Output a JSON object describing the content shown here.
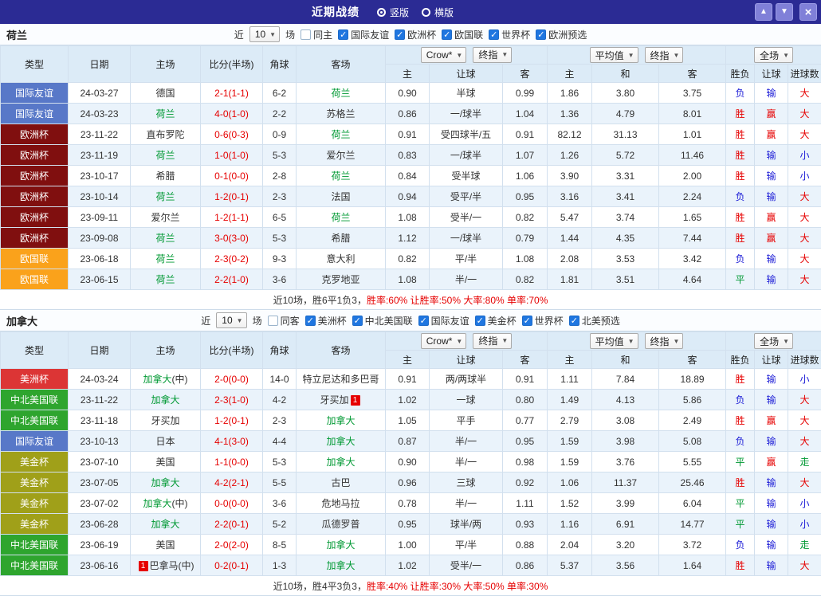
{
  "titlebar": {
    "title": "近期战绩",
    "radios": [
      {
        "label": "竖版",
        "selected": true
      },
      {
        "label": "横版",
        "selected": false
      }
    ],
    "buttons": {
      "up": "▲",
      "down": "▼",
      "close": "×"
    }
  },
  "colors": {
    "league": {
      "国际友谊": "#5878c8",
      "欧洲杯": "#800f0f",
      "欧国联": "#faa21b",
      "美洲杯": "#dc3535",
      "中北美国联": "#2ea52e",
      "美金杯": "#a0a019"
    },
    "result": {
      "胜": "#e60000",
      "负": "#1a1ad6",
      "平": "#009933",
      "赢": "#e60000",
      "输": "#1a1ad6",
      "大": "#e60000",
      "小": "#1a1ad6",
      "走": "#009933"
    }
  },
  "table_header": {
    "cols": [
      "类型",
      "日期",
      "主场",
      "比分(半场)",
      "角球",
      "客场"
    ],
    "sub": [
      "主",
      "让球",
      "客",
      "主",
      "和",
      "客",
      "胜负",
      "让球",
      "进球数"
    ],
    "selects": {
      "odds1": "Crow*",
      "odds2": "终指",
      "avg1": "平均值",
      "avg2": "终指",
      "scope": "全场"
    }
  },
  "sections": [
    {
      "team": "荷兰",
      "filter": {
        "near_label": "近",
        "count": "10",
        "games_label": "场",
        "same_label": "同主",
        "same_checked": false,
        "leagues": [
          {
            "label": "国际友谊",
            "checked": true
          },
          {
            "label": "欧洲杯",
            "checked": true
          },
          {
            "label": "欧国联",
            "checked": true
          },
          {
            "label": "世界杯",
            "checked": true
          },
          {
            "label": "欧洲预选",
            "checked": true
          }
        ]
      },
      "rows": [
        {
          "league": "国际友谊",
          "date": "24-03-27",
          "home": [
            {
              "text": "德国"
            }
          ],
          "score": "2-1(1-1)",
          "corner": "6-2",
          "away": [
            {
              "text": "荷兰",
              "focus": true
            }
          ],
          "odds": [
            "0.90",
            "半球",
            "0.99"
          ],
          "avg": [
            "1.86",
            "3.80",
            "3.75"
          ],
          "res": [
            "负",
            "输",
            "大"
          ]
        },
        {
          "league": "国际友谊",
          "date": "24-03-23",
          "home": [
            {
              "text": "荷兰",
              "focus": true
            }
          ],
          "score": "4-0(1-0)",
          "corner": "2-2",
          "away": [
            {
              "text": "苏格兰"
            }
          ],
          "odds": [
            "0.86",
            "一/球半",
            "1.04"
          ],
          "avg": [
            "1.36",
            "4.79",
            "8.01"
          ],
          "res": [
            "胜",
            "赢",
            "大"
          ]
        },
        {
          "league": "欧洲杯",
          "date": "23-11-22",
          "home": [
            {
              "text": "直布罗陀"
            }
          ],
          "score": "0-6(0-3)",
          "corner": "0-9",
          "away": [
            {
              "text": "荷兰",
              "focus": true
            }
          ],
          "odds": [
            "0.91",
            "受四球半/五",
            "0.91"
          ],
          "avg": [
            "82.12",
            "31.13",
            "1.01"
          ],
          "res": [
            "胜",
            "赢",
            "大"
          ]
        },
        {
          "league": "欧洲杯",
          "date": "23-11-19",
          "home": [
            {
              "text": "荷兰",
              "focus": true
            }
          ],
          "score": "1-0(1-0)",
          "corner": "5-3",
          "away": [
            {
              "text": "爱尔兰"
            }
          ],
          "odds": [
            "0.83",
            "一/球半",
            "1.07"
          ],
          "avg": [
            "1.26",
            "5.72",
            "11.46"
          ],
          "res": [
            "胜",
            "输",
            "小"
          ]
        },
        {
          "league": "欧洲杯",
          "date": "23-10-17",
          "home": [
            {
              "text": "希腊"
            }
          ],
          "score": "0-1(0-0)",
          "corner": "2-8",
          "away": [
            {
              "text": "荷兰",
              "focus": true
            }
          ],
          "odds": [
            "0.84",
            "受半球",
            "1.06"
          ],
          "avg": [
            "3.90",
            "3.31",
            "2.00"
          ],
          "res": [
            "胜",
            "输",
            "小"
          ]
        },
        {
          "league": "欧洲杯",
          "date": "23-10-14",
          "home": [
            {
              "text": "荷兰",
              "focus": true
            }
          ],
          "score": "1-2(0-1)",
          "corner": "2-3",
          "away": [
            {
              "text": "法国"
            }
          ],
          "odds": [
            "0.94",
            "受平/半",
            "0.95"
          ],
          "avg": [
            "3.16",
            "3.41",
            "2.24"
          ],
          "res": [
            "负",
            "输",
            "大"
          ]
        },
        {
          "league": "欧洲杯",
          "date": "23-09-11",
          "home": [
            {
              "text": "爱尔兰"
            }
          ],
          "score": "1-2(1-1)",
          "corner": "6-5",
          "away": [
            {
              "text": "荷兰",
              "focus": true
            }
          ],
          "odds": [
            "1.08",
            "受半/一",
            "0.82"
          ],
          "avg": [
            "5.47",
            "3.74",
            "1.65"
          ],
          "res": [
            "胜",
            "赢",
            "大"
          ]
        },
        {
          "league": "欧洲杯",
          "date": "23-09-08",
          "home": [
            {
              "text": "荷兰",
              "focus": true
            }
          ],
          "score": "3-0(3-0)",
          "corner": "5-3",
          "away": [
            {
              "text": "希腊"
            }
          ],
          "odds": [
            "1.12",
            "一/球半",
            "0.79"
          ],
          "avg": [
            "1.44",
            "4.35",
            "7.44"
          ],
          "res": [
            "胜",
            "赢",
            "大"
          ]
        },
        {
          "league": "欧国联",
          "date": "23-06-18",
          "home": [
            {
              "text": "荷兰",
              "focus": true
            }
          ],
          "score": "2-3(0-2)",
          "corner": "9-3",
          "away": [
            {
              "text": "意大利"
            }
          ],
          "odds": [
            "0.82",
            "平/半",
            "1.08"
          ],
          "avg": [
            "2.08",
            "3.53",
            "3.42"
          ],
          "res": [
            "负",
            "输",
            "大"
          ]
        },
        {
          "league": "欧国联",
          "date": "23-06-15",
          "home": [
            {
              "text": "荷兰",
              "focus": true
            }
          ],
          "score": "2-2(1-0)",
          "corner": "3-6",
          "away": [
            {
              "text": "克罗地亚"
            }
          ],
          "odds": [
            "1.08",
            "半/一",
            "0.82"
          ],
          "avg": [
            "1.81",
            "3.51",
            "4.64"
          ],
          "res": [
            "平",
            "输",
            "大"
          ]
        }
      ],
      "summary": [
        {
          "text": "近10场，胜6平1负3，",
          "color": "#333333"
        },
        {
          "text": "胜率:60%",
          "color": "#e60000"
        },
        {
          "text": " 让胜率:50%",
          "color": "#e60000"
        },
        {
          "text": " 大率:80%",
          "color": "#e60000"
        },
        {
          "text": " 单率:70%",
          "color": "#e60000"
        }
      ]
    },
    {
      "team": "加拿大",
      "filter": {
        "near_label": "近",
        "count": "10",
        "games_label": "场",
        "same_label": "同客",
        "same_checked": false,
        "leagues": [
          {
            "label": "美洲杯",
            "checked": true
          },
          {
            "label": "中北美国联",
            "checked": true
          },
          {
            "label": "国际友谊",
            "checked": true
          },
          {
            "label": "美金杯",
            "checked": true
          },
          {
            "label": "世界杯",
            "checked": true
          },
          {
            "label": "北美预选",
            "checked": true
          }
        ]
      },
      "rows": [
        {
          "league": "美洲杯",
          "date": "24-03-24",
          "home": [
            {
              "text": "加拿大",
              "focus": true
            },
            {
              "text": "(中)"
            }
          ],
          "score": "2-0(0-0)",
          "corner": "14-0",
          "away": [
            {
              "text": "特立尼达和多巴哥"
            }
          ],
          "odds": [
            "0.91",
            "两/两球半",
            "0.91"
          ],
          "avg": [
            "1.11",
            "7.84",
            "18.89"
          ],
          "res": [
            "胜",
            "输",
            "小"
          ]
        },
        {
          "league": "中北美国联",
          "date": "23-11-22",
          "home": [
            {
              "text": "加拿大",
              "focus": true
            }
          ],
          "score": "2-3(1-0)",
          "corner": "4-2",
          "away": [
            {
              "text": "牙买加"
            },
            {
              "card": "1"
            }
          ],
          "odds": [
            "1.02",
            "一球",
            "0.80"
          ],
          "avg": [
            "1.49",
            "4.13",
            "5.86"
          ],
          "res": [
            "负",
            "输",
            "大"
          ]
        },
        {
          "league": "中北美国联",
          "date": "23-11-18",
          "home": [
            {
              "text": "牙买加"
            }
          ],
          "score": "1-2(0-1)",
          "corner": "2-3",
          "away": [
            {
              "text": "加拿大",
              "focus": true
            }
          ],
          "odds": [
            "1.05",
            "平手",
            "0.77"
          ],
          "avg": [
            "2.79",
            "3.08",
            "2.49"
          ],
          "res": [
            "胜",
            "赢",
            "大"
          ]
        },
        {
          "league": "国际友谊",
          "date": "23-10-13",
          "home": [
            {
              "text": "日本"
            }
          ],
          "score": "4-1(3-0)",
          "corner": "4-4",
          "away": [
            {
              "text": "加拿大",
              "focus": true
            }
          ],
          "odds": [
            "0.87",
            "半/一",
            "0.95"
          ],
          "avg": [
            "1.59",
            "3.98",
            "5.08"
          ],
          "res": [
            "负",
            "输",
            "大"
          ]
        },
        {
          "league": "美金杯",
          "date": "23-07-10",
          "home": [
            {
              "text": "美国"
            }
          ],
          "score": "1-1(0-0)",
          "corner": "5-3",
          "away": [
            {
              "text": "加拿大",
              "focus": true
            }
          ],
          "odds": [
            "0.90",
            "半/一",
            "0.98"
          ],
          "avg": [
            "1.59",
            "3.76",
            "5.55"
          ],
          "res": [
            "平",
            "赢",
            "走"
          ]
        },
        {
          "league": "美金杯",
          "date": "23-07-05",
          "home": [
            {
              "text": "加拿大",
              "focus": true
            }
          ],
          "score": "4-2(2-1)",
          "corner": "5-5",
          "away": [
            {
              "text": "古巴"
            }
          ],
          "odds": [
            "0.96",
            "三球",
            "0.92"
          ],
          "avg": [
            "1.06",
            "11.37",
            "25.46"
          ],
          "res": [
            "胜",
            "输",
            "大"
          ]
        },
        {
          "league": "美金杯",
          "date": "23-07-02",
          "home": [
            {
              "text": "加拿大",
              "focus": true
            },
            {
              "text": "(中)"
            }
          ],
          "score": "0-0(0-0)",
          "corner": "3-6",
          "away": [
            {
              "text": "危地马拉"
            }
          ],
          "odds": [
            "0.78",
            "半/一",
            "1.11"
          ],
          "avg": [
            "1.52",
            "3.99",
            "6.04"
          ],
          "res": [
            "平",
            "输",
            "小"
          ]
        },
        {
          "league": "美金杯",
          "date": "23-06-28",
          "home": [
            {
              "text": "加拿大",
              "focus": true
            }
          ],
          "score": "2-2(0-1)",
          "corner": "5-2",
          "away": [
            {
              "text": "瓜德罗普"
            }
          ],
          "odds": [
            "0.95",
            "球半/两",
            "0.93"
          ],
          "avg": [
            "1.16",
            "6.91",
            "14.77"
          ],
          "res": [
            "平",
            "输",
            "小"
          ]
        },
        {
          "league": "中北美国联",
          "date": "23-06-19",
          "home": [
            {
              "text": "美国"
            }
          ],
          "score": "2-0(2-0)",
          "corner": "8-5",
          "away": [
            {
              "text": "加拿大",
              "focus": true
            }
          ],
          "odds": [
            "1.00",
            "平/半",
            "0.88"
          ],
          "avg": [
            "2.04",
            "3.20",
            "3.72"
          ],
          "res": [
            "负",
            "输",
            "走"
          ]
        },
        {
          "league": "中北美国联",
          "date": "23-06-16",
          "home": [
            {
              "card": "1"
            },
            {
              "text": "巴拿马(中)"
            }
          ],
          "score": "0-2(0-1)",
          "corner": "1-3",
          "away": [
            {
              "text": "加拿大",
              "focus": true
            }
          ],
          "odds": [
            "1.02",
            "受半/一",
            "0.86"
          ],
          "avg": [
            "5.37",
            "3.56",
            "1.64"
          ],
          "res": [
            "胜",
            "输",
            "大"
          ]
        }
      ],
      "summary": [
        {
          "text": "近10场，胜4平3负3，",
          "color": "#333333"
        },
        {
          "text": "胜率:40%",
          "color": "#e60000"
        },
        {
          "text": " 让胜率:30%",
          "color": "#e60000"
        },
        {
          "text": " 大率:50%",
          "color": "#e60000"
        },
        {
          "text": " 单率:30%",
          "color": "#e60000"
        }
      ]
    }
  ]
}
